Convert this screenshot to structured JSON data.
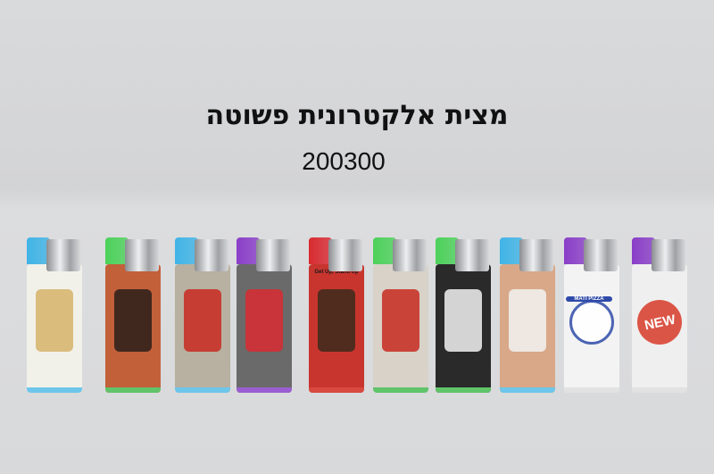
{
  "title": "מצית אלקטרונית פשוטה",
  "product_code": "200300",
  "lighters": [
    {
      "name": "chef-pizza",
      "tank": "#40b4e6",
      "bg": "#f1f1ea",
      "accent": "#d6b36a",
      "base": "#6ec6ea"
    },
    {
      "name": "hand-phone",
      "tank": "#4cd15a",
      "bg": "#c2603a",
      "accent": "#2a1e1a",
      "base": "#60c46a"
    },
    {
      "name": "london-phonebox",
      "tank": "#40b4e6",
      "bg": "#b8b0a0",
      "accent": "#c82a20",
      "base": "#6ec6ea"
    },
    {
      "name": "london-collage",
      "tank": "#8a3ec8",
      "bg": "#6a6a6a",
      "accent": "#d82a30",
      "base": "#9a5ed2"
    },
    {
      "name": "fist-stand-up",
      "tank": "#d82a30",
      "bg": "#c8352e",
      "accent": "#3a2a1a",
      "base": "#d84a40"
    },
    {
      "name": "big-ben-bus",
      "tank": "#4cd15a",
      "bg": "#d8d2c8",
      "accent": "#c82a20",
      "base": "#60c46a"
    },
    {
      "name": "cigarette-figure",
      "tank": "#4cd15a",
      "bg": "#2a2a2a",
      "accent": "#f2f2f2",
      "base": "#60c46a"
    },
    {
      "name": "hand-cigarette",
      "tank": "#40b4e6",
      "bg": "#d8a888",
      "accent": "#f2f2f2",
      "base": "#6ec6ea"
    },
    {
      "name": "mati-pizza",
      "tank": "#8a3ec8",
      "bg": "#f3f3f3",
      "accent": "#2e4aa8",
      "base": "#e2e2e2"
    },
    {
      "name": "new-badge",
      "tank": "#8a3ec8",
      "bg": "#efefef",
      "accent": "#d83a28",
      "base": "#e2e2e2"
    }
  ],
  "labels": {
    "mati_pizza": "MATI PIZZA",
    "new": "NEW",
    "stand_up": "Get Up, Stand Up"
  }
}
